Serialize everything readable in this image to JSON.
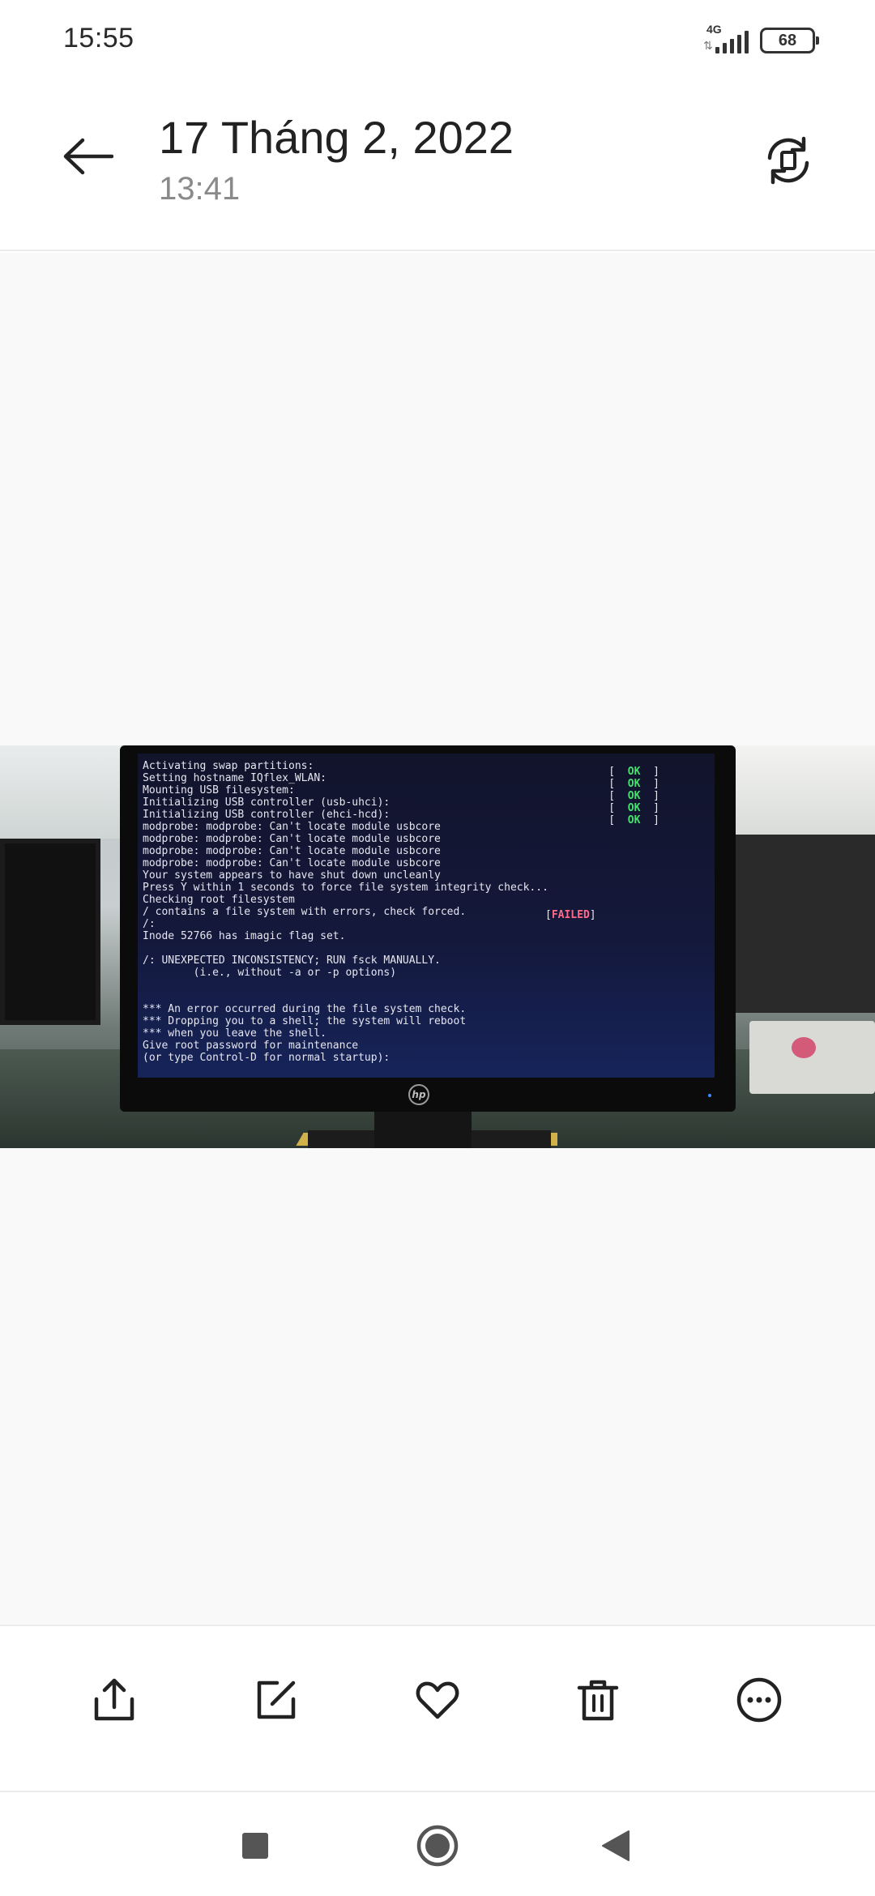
{
  "status_bar": {
    "time": "15:55",
    "network_type": "4G",
    "battery_level": "68"
  },
  "header": {
    "title": "17 Tháng 2, 2022",
    "subtitle": "13:41",
    "back_icon": "arrow-left-icon",
    "rotate_icon": "rotate-icon"
  },
  "photo": {
    "brand_logo": "hp",
    "terminal_lines": [
      "Activating swap partitions:",
      "Setting hostname IQflex_WLAN:",
      "Mounting USB filesystem:",
      "Initializing USB controller (usb-uhci):",
      "Initializing USB controller (ehci-hcd):",
      "modprobe: modprobe: Can't locate module usbcore",
      "modprobe: modprobe: Can't locate module usbcore",
      "modprobe: modprobe: Can't locate module usbcore",
      "modprobe: modprobe: Can't locate module usbcore",
      "Your system appears to have shut down uncleanly",
      "Press Y within 1 seconds to force file system integrity check...",
      "Checking root filesystem",
      "/ contains a file system with errors, check forced.",
      "/:",
      "Inode 52766 has imagic flag set.",
      "",
      "/: UNEXPECTED INCONSISTENCY; RUN fsck MANUALLY.",
      "        (i.e., without -a or -p options)",
      "",
      "",
      "*** An error occurred during the file system check.",
      "*** Dropping you to a shell; the system will reboot",
      "*** when you leave the shell.",
      "Give root password for maintenance",
      "(or type Control-D for normal startup):"
    ],
    "ok_label": "OK",
    "failed_label": "FAILED"
  },
  "toolbar": {
    "share_icon": "share-icon",
    "edit_icon": "edit-icon",
    "favorite_icon": "heart-icon",
    "delete_icon": "trash-icon",
    "more_icon": "more-icon"
  },
  "navbar": {
    "recents_icon": "square-icon",
    "home_icon": "home-circle-icon",
    "back_icon": "triangle-back-icon"
  },
  "colors": {
    "ok_green": "#48e06c",
    "failed_red": "#ff6a8a",
    "icon_dark": "#222222"
  }
}
